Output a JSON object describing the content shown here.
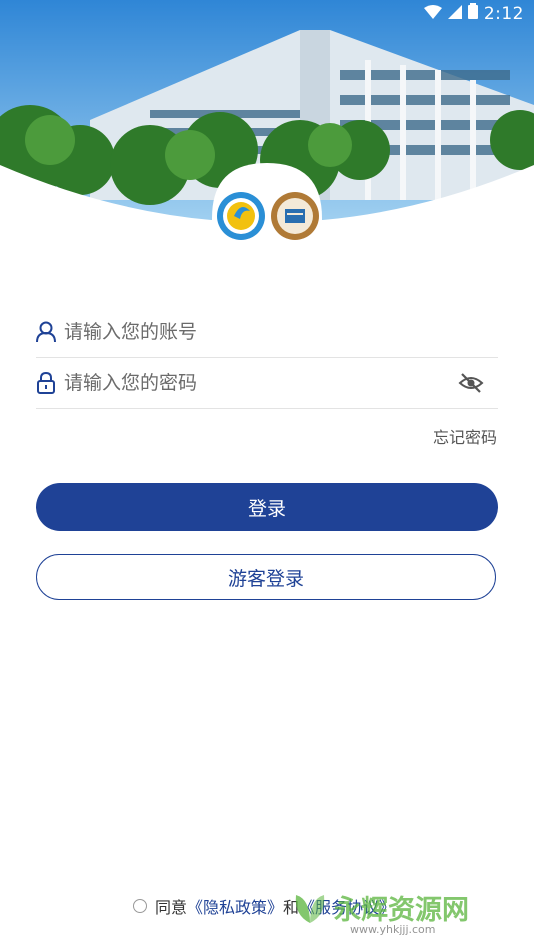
{
  "status_bar": {
    "time": "2:12"
  },
  "header": {
    "logo_left": "school-logo-gear-icon",
    "logo_right": "college-seal-icon"
  },
  "form": {
    "account_placeholder": "请输入您的账号",
    "password_placeholder": "请输入您的密码",
    "forgot_label": "忘记密码",
    "login_label": "登录",
    "guest_login_label": "游客登录"
  },
  "agreement": {
    "prefix": "同意",
    "privacy_link": "《隐私政策》",
    "and": "和",
    "service_link": "《服务协议》"
  },
  "watermark": {
    "text": "永辉资源网",
    "url": "www.yhkjjj.com"
  },
  "colors": {
    "primary": "#1f4296",
    "sky": "#4a9be0"
  }
}
